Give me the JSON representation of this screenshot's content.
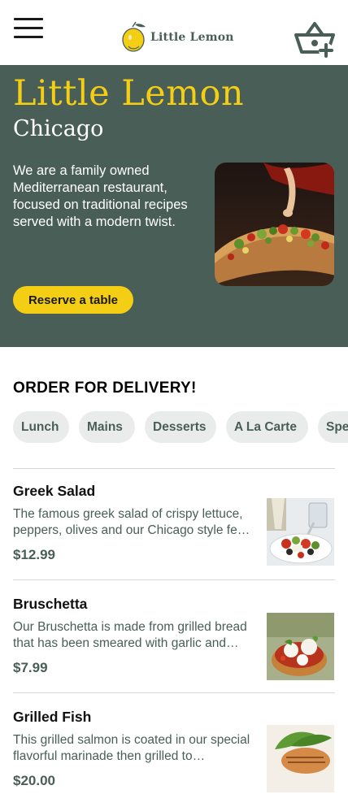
{
  "header": {
    "logo_text": "Little Lemon",
    "menu_icon": "hamburger-menu-icon",
    "cart_icon": "basket-add-icon"
  },
  "hero": {
    "title": "Little Lemon",
    "subtitle": "Chicago",
    "description": "We are a family owned Mediterranean restaurant, focused on traditional recipes served with a modern twist.",
    "reserve_label": "Reserve a table"
  },
  "order": {
    "title": "ORDER FOR DELIVERY!",
    "categories": [
      "Lunch",
      "Mains",
      "Desserts",
      "A La Carte",
      "Specials"
    ]
  },
  "menu": {
    "items": [
      {
        "name": "Greek Salad",
        "description": "The famous greek salad of crispy lettuce, peppers, olives and our Chicago style feta cheese, garnished with crunchy garlic and rosemary croutons.",
        "price": "$12.99"
      },
      {
        "name": "Bruschetta",
        "description": "Our Bruschetta is made from grilled bread that has been smeared with garlic and seasoned with salt and olive oil.",
        "price": "$7.99"
      },
      {
        "name": "Grilled Fish",
        "description": "This grilled salmon is coated in our special flavorful marinade then grilled to perfection.",
        "price": "$20.00"
      }
    ]
  },
  "colors": {
    "primary_green": "#495E57",
    "primary_yellow": "#F4CE14",
    "chip_bg": "#EAECEB",
    "divider": "#D6D6D6"
  }
}
